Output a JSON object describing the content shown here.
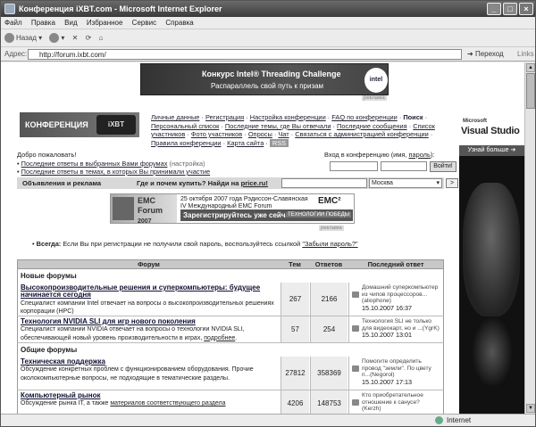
{
  "window": {
    "title": "Конференция iXBT.com - Microsoft Internet Explorer"
  },
  "menu": [
    "Файл",
    "Правка",
    "Вид",
    "Избранное",
    "Сервис",
    "Справка"
  ],
  "toolbar": {
    "back": "Назад"
  },
  "address": {
    "label": "Адрес:",
    "url": "http://forum.ixbt.com/",
    "go": "Переход",
    "links": "Links"
  },
  "status": {
    "zone": "Internet"
  },
  "banner": {
    "title": "Конкурс Intel® Threading Challenge",
    "subtitle": "Распараллель свой путь к призам",
    "logo": "intel",
    "tag": "реклама"
  },
  "header": {
    "logo": "КОНФЕРЕНЦИЯ",
    "logo2": "iXBT"
  },
  "nav": {
    "line1": [
      "Личные данные",
      "Регистрация",
      "Настройка конференции",
      "FAQ по конференции"
    ],
    "search": "Поиск",
    "line2": [
      "Персональный список",
      "Последние темы, где Вы отвечали",
      "Последние сообщения",
      "Список участников",
      "Фото участников",
      "Опросы",
      "Чат",
      "Связаться с администрацией конференции",
      "Правила конференции",
      "Карта сайта"
    ],
    "rss": "RSS"
  },
  "ms_ad": {
    "brand": "Microsoft",
    "product": "Visual Studio",
    "more": "Узнай больше ➔"
  },
  "welcome": "Добро пожаловать!",
  "login": {
    "text": "Вход в конференцию (имя,",
    "link": "пароль",
    "close": "):",
    "button": "Войти!"
  },
  "last": {
    "items": [
      {
        "link": "Последние ответы в выбранных Вами форумах",
        "extra": "(настройка)"
      },
      {
        "link": "Последние ответы в темах, в которых Вы принимали участие",
        "extra": ""
      }
    ]
  },
  "ads": {
    "label": "Объявления и реклама",
    "q": "Где и почем купить? Найди на ",
    "q_link": "price.ru!",
    "city": "Москва",
    "go": ">"
  },
  "emc": {
    "left": "EMC Forum",
    "left2": "2007",
    "line1": "25 октября 2007 года Рэдиссон-Славянская",
    "line2": "IV Международный EMC Forum",
    "cta": "Зарегистрируйтесь уже сейчас!",
    "logo": "EMC²",
    "tag2": "ТЕХНОЛОГИИ ПОБЕДЫ",
    "tag": "реклама"
  },
  "always": {
    "label": "Всегда:",
    "text": " Если Вы при регистрации не получили свой пароль, воспользуйтесь ссылкой ",
    "link": "\"Забыли пароль?\""
  },
  "table": {
    "headers": [
      "Форум",
      "Тем",
      "Ответов",
      "Последний ответ"
    ],
    "sections": [
      {
        "name": "Новые форумы",
        "rows": [
          {
            "title": "Высокопроизводительные решения и суперкомпьютеры: будущее начинается сегодня",
            "desc": "Специалист компании Intel отвечает на вопросы о высокопроизводительных решениях корпорации (HPC)",
            "topics": "267",
            "replies": "2166",
            "last": "Домашний суперкомпьютер из чипов процессоров...(aliophone)",
            "date": "15.10.2007 16:37"
          },
          {
            "title": "Технология NVIDIA SLI для игр нового поколения",
            "desc": "Специалист компании NVIDIA отвечает на вопросы о технологии NVIDIA SLI, обеспечивающей новый уровень производительности в играх, ",
            "desc_link": "подробнее",
            "desc_end": ".",
            "topics": "57",
            "replies": "254",
            "last": "Технология SLI не только для видеокарт, но и ...(YgrK)",
            "date": "15.10.2007 13:01"
          }
        ]
      },
      {
        "name": "Общие форумы",
        "rows": [
          {
            "title": "Техническая поддержка",
            "desc": "Обсуждение конкретных проблем с функционированием оборудования. Прочие околокомпьютерные вопросы, не подходящие в тематические разделы.",
            "topics": "27812",
            "replies": "358369",
            "last": "Помогите определить провод \"земли\". По цвету п...(Negorol)",
            "date": "15.10.2007 17:13"
          },
          {
            "title": "Компьютерный рынок",
            "desc": "Обсуждение рынка IT, а также ",
            "desc_link": "материалов соответствующего раздела",
            "topics": "4206",
            "replies": "148753",
            "last": "Кто приобретательное отношение к санусе? (Kerzh)",
            "date": ""
          }
        ]
      }
    ]
  }
}
